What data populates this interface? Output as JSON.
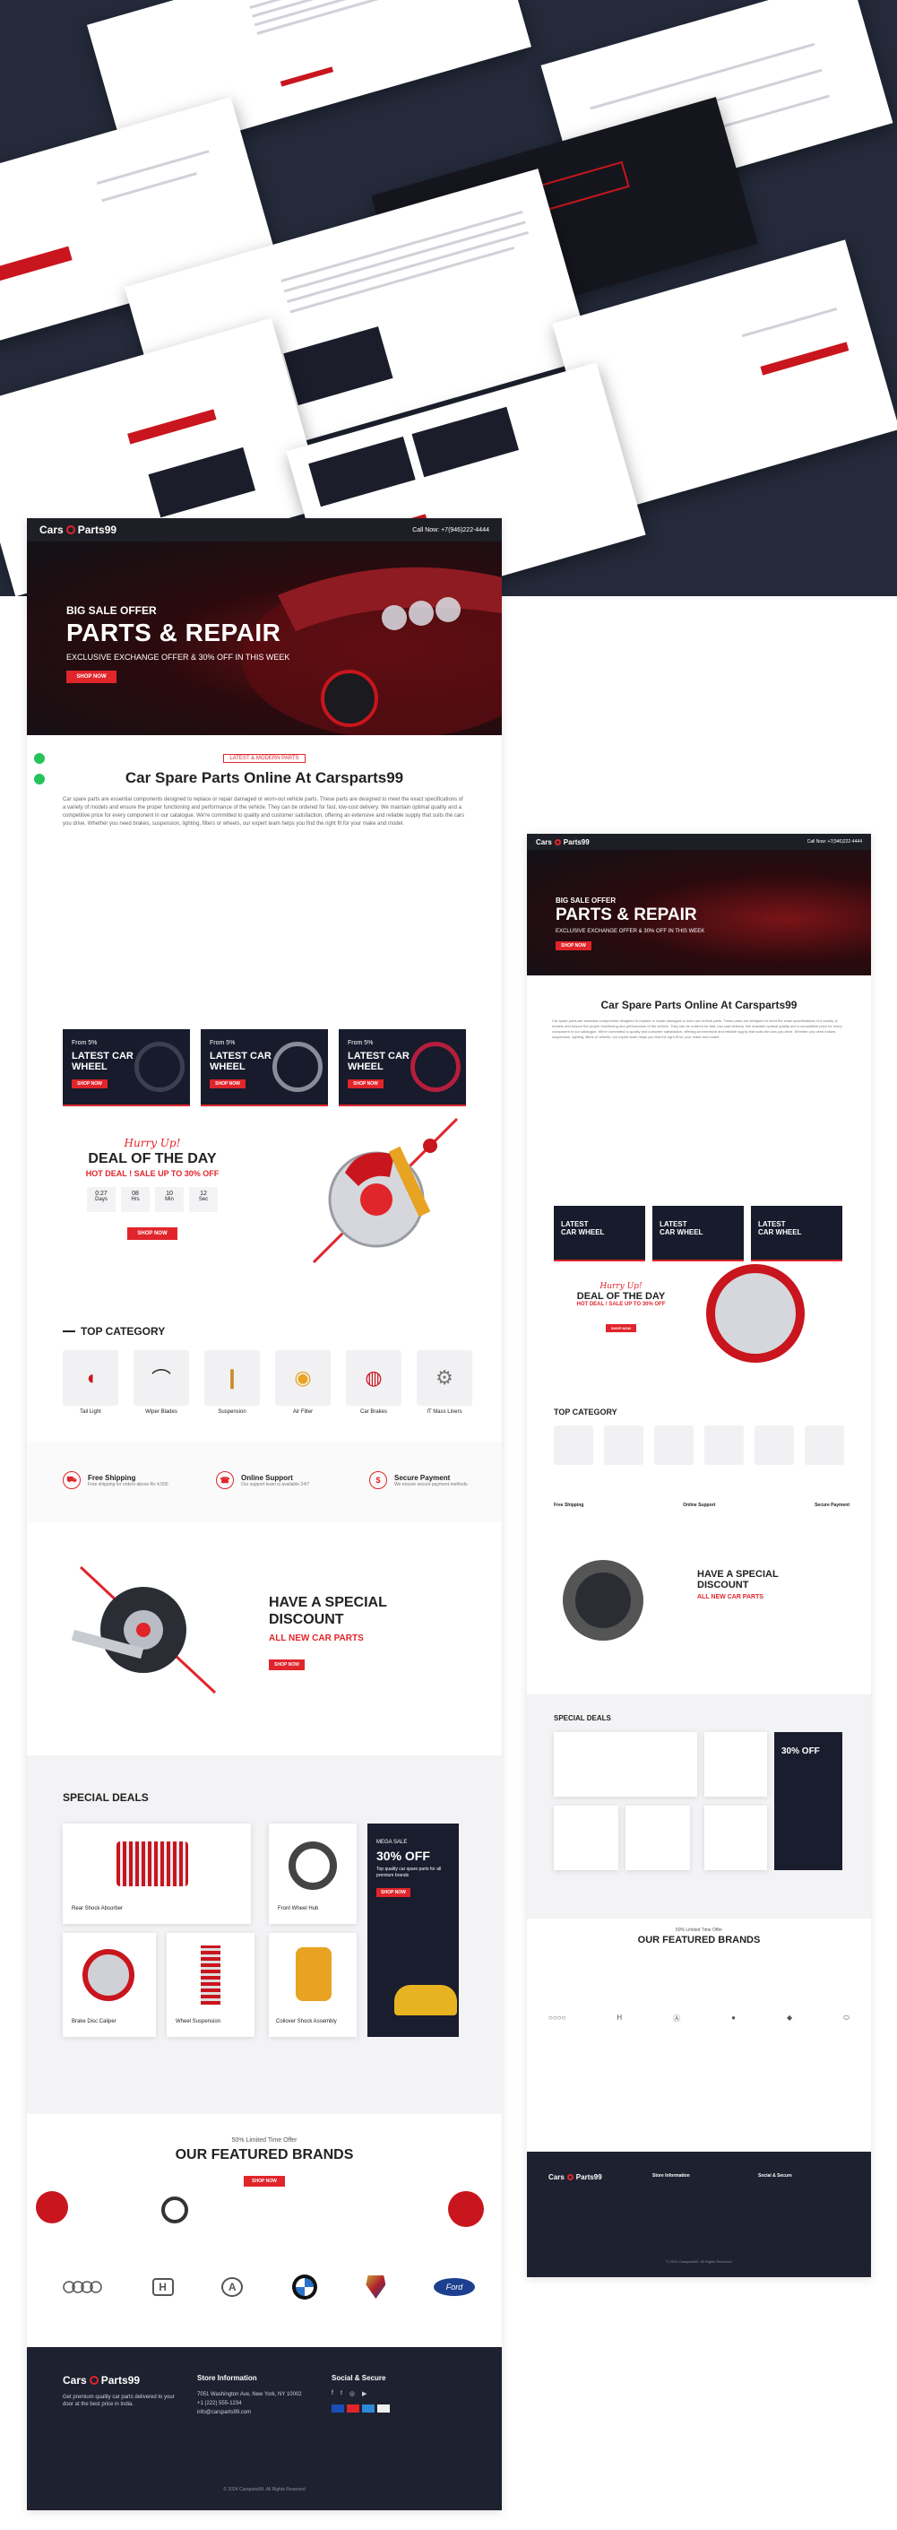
{
  "header": {
    "logo_prefix": "Cars",
    "logo_suffix": "Parts99",
    "call_text": "Call Now: +7(946)222-4444"
  },
  "hero": {
    "eyebrow": "BIG SALE OFFER",
    "title": "PARTS & REPAIR",
    "subtitle": "EXCLUSIVE EXCHANGE OFFER & 30% OFF IN THIS WEEK",
    "button": "SHOP NOW"
  },
  "intro": {
    "badge": "LATEST & MODERN PARTS",
    "title": "Car Spare Parts Online At Carsparts99",
    "paragraph": "Car spare parts are essential components designed to replace or repair damaged or worn-out vehicle parts. These parts are designed to meet the exact specifications of a variety of models and ensure the proper functioning and performance of the vehicle. They can be ordered for fast, low-cost delivery. We maintain optimal quality and a competitive price for every component in our catalogue. We're committed to quality and customer satisfaction, offering an extensive and reliable supply that suits the cars you drive. Whether you need brakes, suspension, lighting, filters or wheels, our expert team helps you find the right fit for your make and model."
  },
  "promos": [
    {
      "from": "From 5%",
      "title": "LATEST CAR WHEEL",
      "button": "SHOP NOW"
    },
    {
      "from": "From 5%",
      "title": "LATEST CAR WHEEL",
      "button": "SHOP NOW"
    },
    {
      "from": "From 5%",
      "title": "LATEST CAR WHEEL",
      "button": "SHOP NOW"
    }
  ],
  "deal": {
    "script": "Hurry Up!",
    "title": "DEAL OF THE DAY",
    "subtitle": "HOT DEAL ! SALE UP TO 30% OFF",
    "countdown": [
      {
        "value": "0:27",
        "unit": "Days"
      },
      {
        "value": "08",
        "unit": "Hrs"
      },
      {
        "value": "10",
        "unit": "Min"
      },
      {
        "value": "12",
        "unit": "Sec"
      }
    ],
    "button": "SHOP NOW"
  },
  "top_category": {
    "title": "TOP CATEGORY",
    "items": [
      "Tail Light",
      "Wiper Blades",
      "Suspension",
      "Air Filter",
      "Car Brakes",
      "IT Mass Liners"
    ]
  },
  "features": [
    {
      "icon": "truck-icon",
      "title": "Free Shipping",
      "text": "Free shipping for orders above Rs 4,500"
    },
    {
      "icon": "support-icon",
      "title": "Online Support",
      "text": "Our support team is available 24/7"
    },
    {
      "icon": "payment-icon",
      "title": "Secure Payment",
      "text": "We ensure secure payment methods"
    }
  ],
  "special": {
    "title": "HAVE A SPECIAL DISCOUNT",
    "subtitle": "ALL NEW CAR PARTS",
    "button": "SHOP NOW"
  },
  "special_deals": {
    "title": "SPECIAL DEALS",
    "items": [
      "Rear Shock Absorber",
      "Front Wheel Hub",
      "Brake Disc Caliper",
      "Wheel Suspension",
      "Coilover Shock Assembly"
    ],
    "offer": {
      "eyebrow": "MEGA SALE",
      "title": "30% OFF",
      "text": "Top quality car spare parts for all premium brands",
      "button": "SHOP NOW"
    }
  },
  "brands": {
    "eyebrow": "50% Limited Time Offer",
    "title": "OUR FEATURED BRANDS",
    "button": "SHOP NOW",
    "items": [
      "audi-logo",
      "honda-logo",
      "acura-logo",
      "bmw-logo",
      "cadillac-logo",
      "ford-logo"
    ]
  },
  "footer": {
    "about": "Get premium quality car parts delivered to your door at the best price in India.",
    "store_title": "Store Information",
    "store_lines": [
      "7051 Washington Ave, New York, NY 10002",
      "+1 (222) 555-1234",
      "info@carsparts99.com"
    ],
    "social_title": "Social & Secure",
    "copyright": "© 2024 Carsparts99. All Rights Reserved"
  },
  "colors": {
    "accent": "#e0252b",
    "dark": "#1e1f26",
    "hero_bg": "#242a3a"
  }
}
